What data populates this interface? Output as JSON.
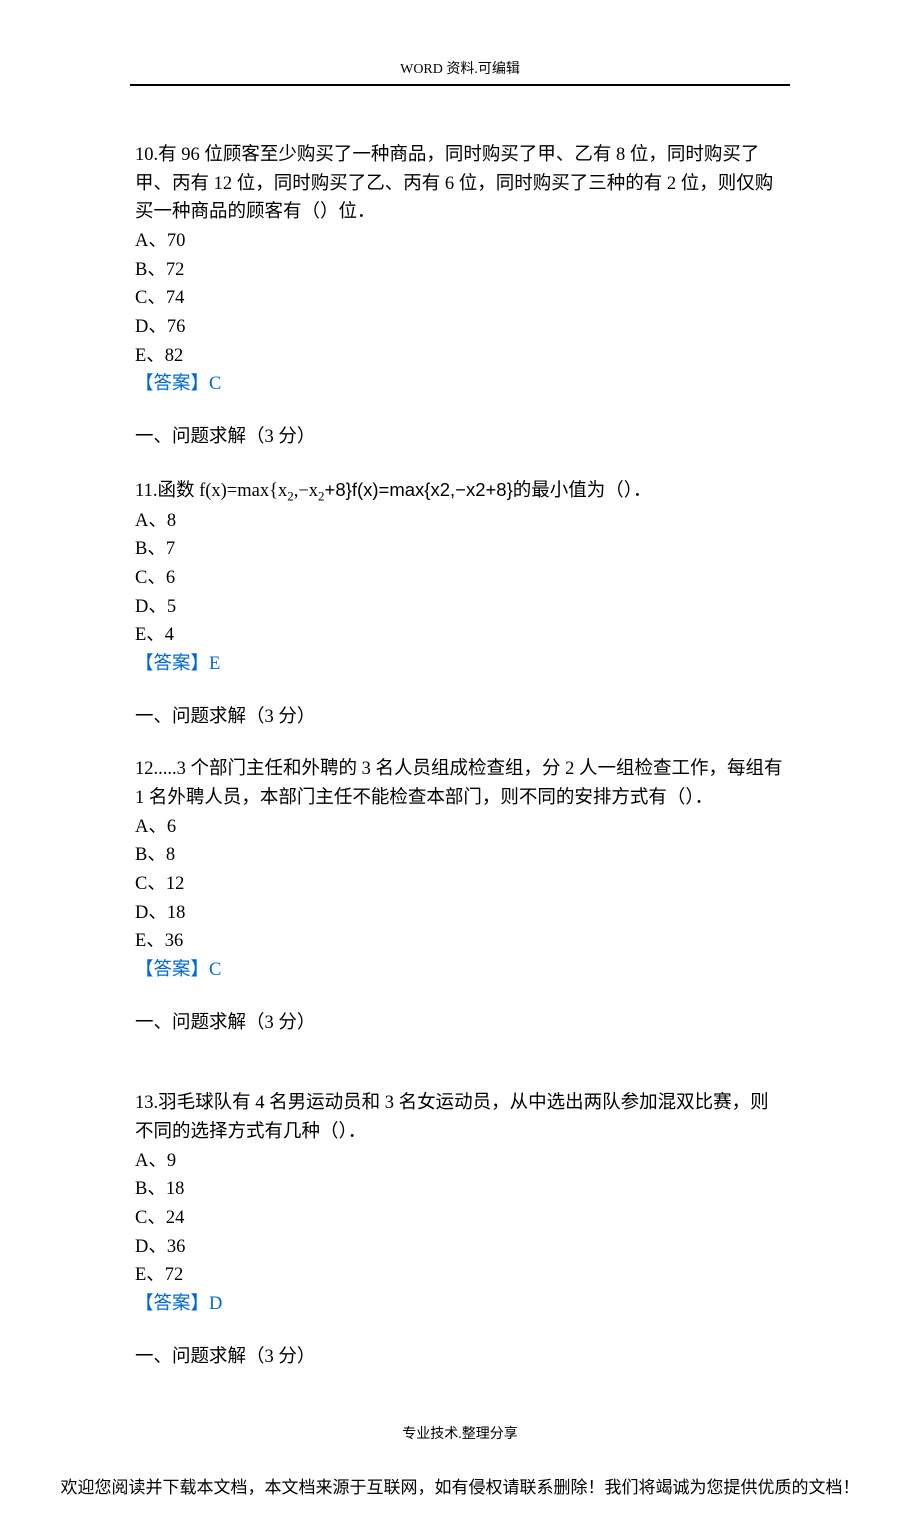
{
  "header": {
    "text": "WORD 资料.可编辑"
  },
  "questions": [
    {
      "number": "10",
      "text": "有 96 位顾客至少购买了一种商品，同时购买了甲、乙有 8 位，同时购买了甲、丙有 12 位，同时购买了乙、丙有 6 位，同时购买了三种的有 2 位，则仅购买一种商品的顾客有（）位．",
      "options": [
        "A、70",
        "B、72",
        "C、74",
        "D、76",
        "E、82"
      ],
      "answer": "【答案】C"
    },
    {
      "number": "11",
      "text_prefix": "函数 f(x)=max{x",
      "text_sub1": "2",
      "text_mid": ",−x",
      "text_sub2": "2",
      "text_suffix": "+8}f(x)=max{x2,−x2+8}的最小值为（）．",
      "options": [
        "A、8",
        "B、7",
        "C、6",
        "D、5",
        "E、4"
      ],
      "answer": "【答案】E"
    },
    {
      "number": "12",
      "text": "....3 个部门主任和外聘的 3 名人员组成检查组，分 2 人一组检查工作，每组有 1 名外聘人员，本部门主任不能检查本部门，则不同的安排方式有（）．",
      "options": [
        "A、6",
        "B、8",
        "C、12",
        "D、18",
        "E、36"
      ],
      "answer": "【答案】C"
    },
    {
      "number": "13",
      "text": "羽毛球队有 4 名男运动员和 3 名女运动员，从中选出两队参加混双比赛，则不同的选择方式有几种（）．",
      "options": [
        "A、9",
        "B、18",
        "C、24",
        "D、36",
        "E、72"
      ],
      "answer": "【答案】D"
    }
  ],
  "section_label": "一、问题求解（3 分）",
  "footer": {
    "text": "专业技术.整理分享"
  },
  "disclaimer": "欢迎您阅读并下载本文档，本文档来源于互联网，如有侵权请联系删除！我们将竭诚为您提供优质的文档！"
}
